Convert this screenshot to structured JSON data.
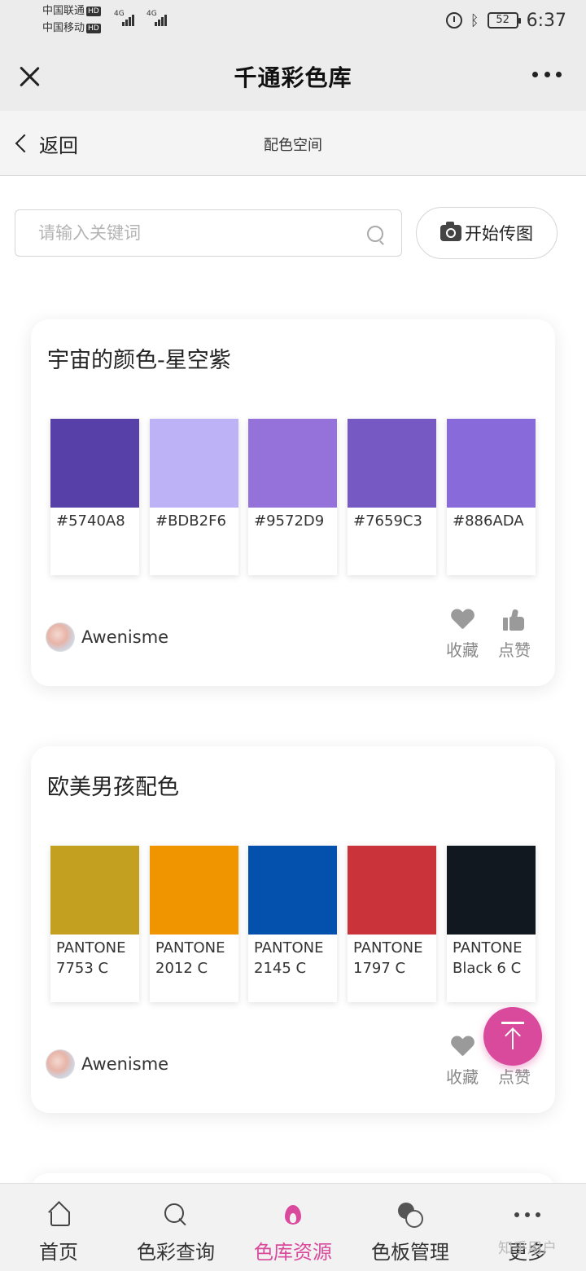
{
  "status_bar": {
    "carrier1": "中国联通",
    "carrier2": "中国移动",
    "hd": "HD",
    "network1": "4G",
    "network2": "4G",
    "battery": "52",
    "time": "6:37"
  },
  "app_bar": {
    "title": "千通彩色库"
  },
  "sub_nav": {
    "back_label": "返回",
    "title": "配色空间"
  },
  "search": {
    "placeholder": "请输入关键词",
    "value": ""
  },
  "upload": {
    "label": "开始传图"
  },
  "cards": [
    {
      "title": "宇宙的颜色-星空紫",
      "swatches": [
        {
          "color": "#5740A8",
          "label": "#5740A8"
        },
        {
          "color": "#BDB2F6",
          "label": "#BDB2F6"
        },
        {
          "color": "#9572D9",
          "label": "#9572D9"
        },
        {
          "color": "#7659C3",
          "label": "#7659C3"
        },
        {
          "color": "#886ADA",
          "label": "#886ADA"
        }
      ],
      "author": "Awenisme",
      "fav_label": "收藏",
      "like_label": "点赞"
    },
    {
      "title": "欧美男孩配色",
      "swatches": [
        {
          "color": "#C4A020",
          "label": "PANTONE\n7753 C"
        },
        {
          "color": "#F09400",
          "label": "PANTONE\n2012 C"
        },
        {
          "color": "#0351AC",
          "label": "PANTONE\n2145 C"
        },
        {
          "color": "#CB333B",
          "label": "PANTONE\n1797 C"
        },
        {
          "color": "#111820",
          "label": "PANTONE\nBlack 6 C"
        }
      ],
      "author": "Awenisme",
      "fav_label": "收藏",
      "like_label": "点赞"
    }
  ],
  "tabs": [
    {
      "label": "首页",
      "icon": "home-icon"
    },
    {
      "label": "色彩查询",
      "icon": "search-icon"
    },
    {
      "label": "色库资源",
      "icon": "flame-icon",
      "active": true
    },
    {
      "label": "色板管理",
      "icon": "palette-icon"
    },
    {
      "label": "更多",
      "icon": "more-icon"
    }
  ],
  "watermark": "知乎用户",
  "colors": {
    "accent": "#D94A9C"
  }
}
